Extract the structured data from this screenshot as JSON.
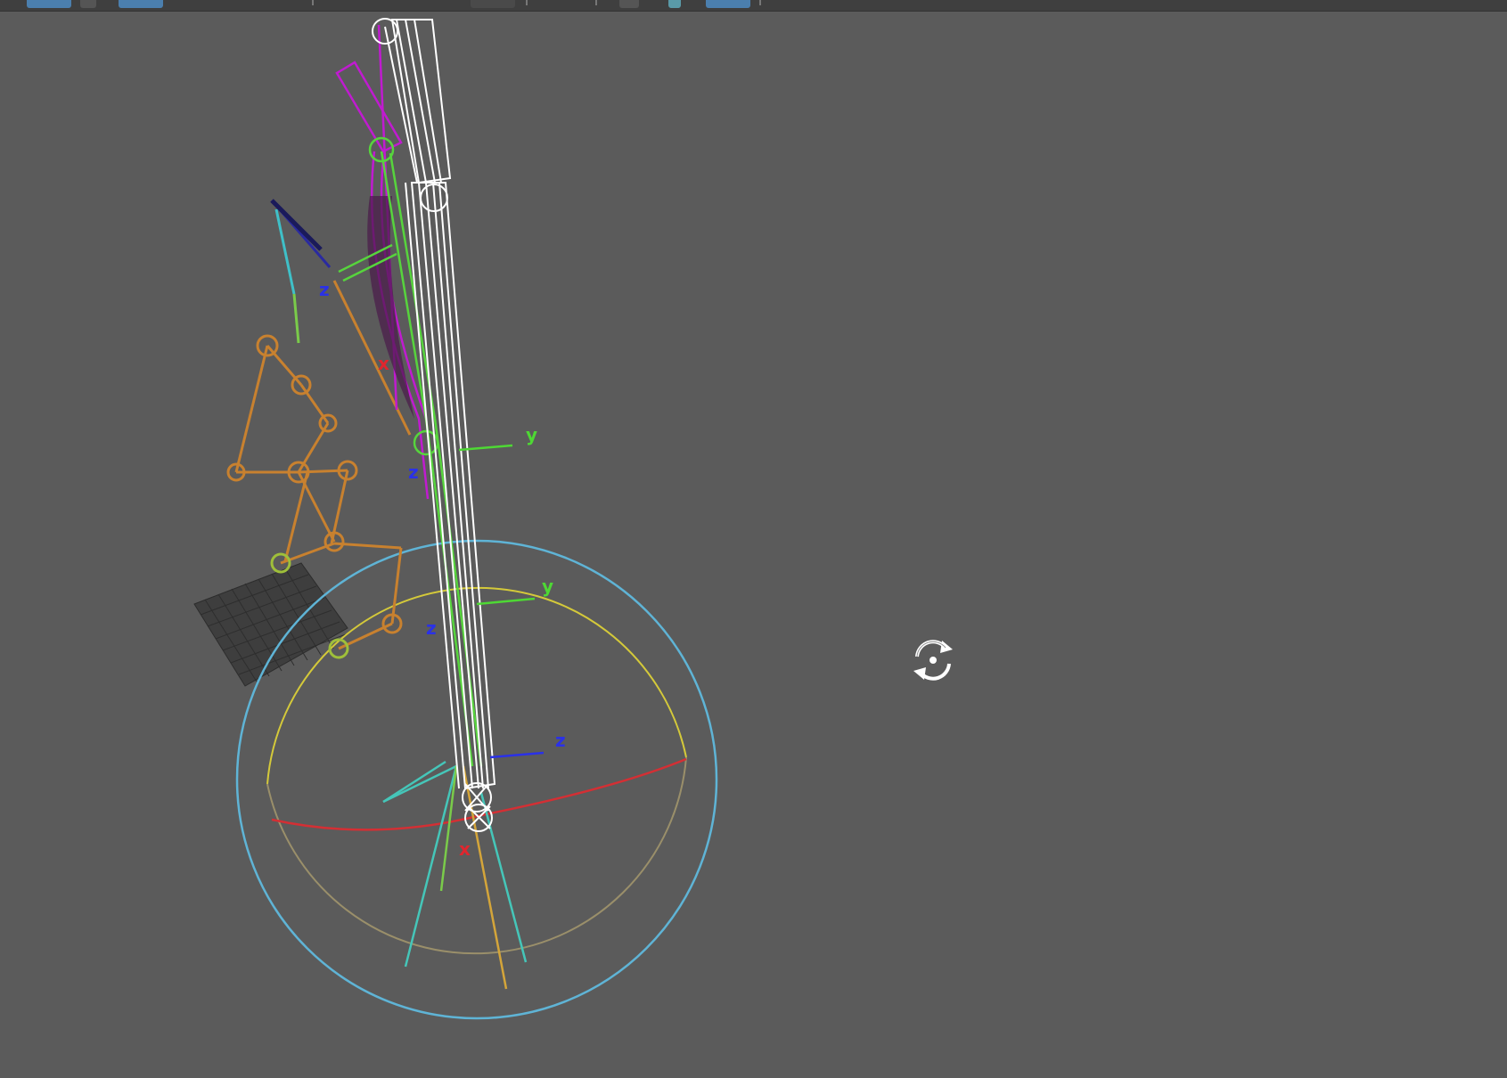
{
  "axis_labels": {
    "upper_y": "y",
    "upper_z": "z",
    "mid_y": "y",
    "mid_z": "z",
    "root_z": "z",
    "root_x": "x",
    "small_z": "z",
    "small_x": "x"
  },
  "colors": {
    "viewport_bg": "#5b5b5b",
    "toolbar_bg": "#3f3f3f",
    "toolbar_accent": "#4b7fae",
    "joint_orange": "#c8812f",
    "control_green": "#57d43d",
    "control_cyan": "#3fc0c8",
    "selection_white": "#ffffff",
    "magenta": "#c01bd0",
    "outer_ring": "#5fb4d6",
    "inner_ring": "#d4c93a",
    "axis_x_red": "#e0262e",
    "axis_y_green": "#4ed834",
    "axis_z_blue": "#2a31e8"
  },
  "icons": {
    "cursor": "tumble-rotate-icon"
  }
}
